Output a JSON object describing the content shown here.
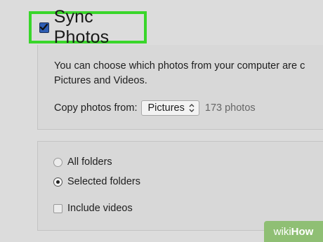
{
  "sync": {
    "label": "Sync Photos",
    "checked": true,
    "highlight_color": "#39d62a"
  },
  "description": {
    "line1": "You can choose which photos from your computer are c",
    "line2": "Pictures and Videos."
  },
  "copy_from": {
    "label": "Copy photos from:",
    "selected": "Pictures",
    "count": "173 photos"
  },
  "folders": {
    "options": [
      {
        "label": "All folders",
        "selected": false
      },
      {
        "label": "Selected folders",
        "selected": true
      }
    ],
    "include_videos": {
      "label": "Include videos",
      "checked": false
    }
  },
  "watermark": {
    "prefix": "wiki",
    "suffix": "How",
    "color": "#8fbf74"
  }
}
